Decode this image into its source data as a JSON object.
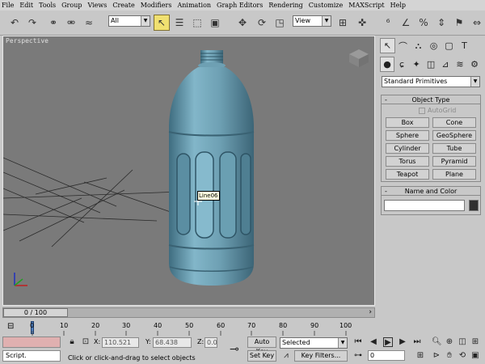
{
  "menu": [
    "File",
    "Edit",
    "Tools",
    "Group",
    "Views",
    "Create",
    "Modifiers",
    "Animation",
    "Graph Editors",
    "Rendering",
    "Customize",
    "MAXScript",
    "Help"
  ],
  "toolbar": {
    "selection_filter": "All",
    "ref_coord": "View",
    "icons": [
      "undo-icon",
      "redo-icon",
      "select-link-icon",
      "unlink-icon",
      "bind-spacewarp-icon",
      "select-object-icon",
      "select-by-name-icon",
      "rectangular-selection-icon",
      "window-crossing-icon",
      "select-move-icon",
      "select-rotate-icon",
      "select-scale-icon",
      "pivot-icon",
      "manipulate-icon",
      "snap-icon",
      "angle-snap-icon",
      "percent-snap-icon",
      "spinner-snap-icon",
      "named-selection-icon",
      "mirror-icon",
      "align-icon",
      "layers-icon",
      "curve-editor-icon",
      "schematic-icon",
      "material-editor-icon",
      "render-scene-icon",
      "quick-render-icon"
    ]
  },
  "viewport": {
    "label": "Perspective",
    "tooltip": "Line06"
  },
  "command_panel": {
    "category": "Standard Primitives",
    "object_type": {
      "title": "Object Type",
      "autogrid": "AutoGrid",
      "buttons": [
        "Box",
        "Cone",
        "Sphere",
        "GeoSphere",
        "Cylinder",
        "Tube",
        "Torus",
        "Pyramid",
        "Teapot",
        "Plane"
      ]
    },
    "name_color": {
      "title": "Name and Color",
      "name_value": "",
      "color": "#303030"
    }
  },
  "timeline": {
    "frame_label": "0 / 100",
    "ticks": [
      "0",
      "10",
      "20",
      "30",
      "40",
      "50",
      "60",
      "70",
      "80",
      "90",
      "100"
    ]
  },
  "status": {
    "script_label": "Script.",
    "x_label": "X:",
    "x_value": "110.521",
    "y_label": "Y:",
    "y_value": "68.438",
    "z_label": "Z:",
    "z_value": "0.0",
    "prompt": "Click or click-and-drag to select objects",
    "auto_key": "Auto Key",
    "set_key": "Set Key",
    "key_mode": "Selected",
    "key_filters": "Key Filters...",
    "current_frame": "0"
  },
  "colors": {
    "bottle": "#6fa0b4",
    "viewport_bg": "#7a7a7a",
    "active_tool": "#f0e070",
    "auto_key_field": "#e0b0b0"
  }
}
